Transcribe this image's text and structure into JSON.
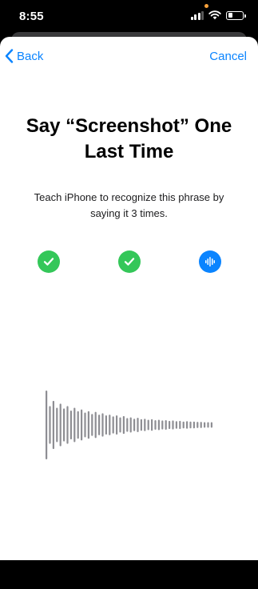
{
  "status_bar": {
    "time": "8:55",
    "signal_bars_filled": 3,
    "signal_bars_total": 4,
    "battery_level": 0.35
  },
  "nav": {
    "back_label": "Back",
    "cancel_label": "Cancel"
  },
  "content": {
    "title": "Say “Screenshot” One Last Time",
    "subtitle": "Teach iPhone to recognize this phrase by saying it 3 times."
  },
  "steps": [
    {
      "state": "complete",
      "icon": "checkmark-icon"
    },
    {
      "state": "complete",
      "icon": "checkmark-icon"
    },
    {
      "state": "listening",
      "icon": "waveform-icon"
    }
  ],
  "waveform_levels": [
    1.0,
    0.55,
    0.7,
    0.5,
    0.62,
    0.48,
    0.55,
    0.42,
    0.5,
    0.4,
    0.45,
    0.36,
    0.4,
    0.32,
    0.38,
    0.3,
    0.34,
    0.28,
    0.3,
    0.25,
    0.28,
    0.22,
    0.26,
    0.2,
    0.22,
    0.18,
    0.21,
    0.17,
    0.18,
    0.15,
    0.17,
    0.14,
    0.15,
    0.13,
    0.14,
    0.12,
    0.13,
    0.11,
    0.12,
    0.1,
    0.11,
    0.1,
    0.1,
    0.09,
    0.09,
    0.08,
    0.08,
    0.08
  ],
  "colors": {
    "accent": "#0a84ff",
    "success": "#34c759",
    "waveform": "#8e8e93"
  }
}
